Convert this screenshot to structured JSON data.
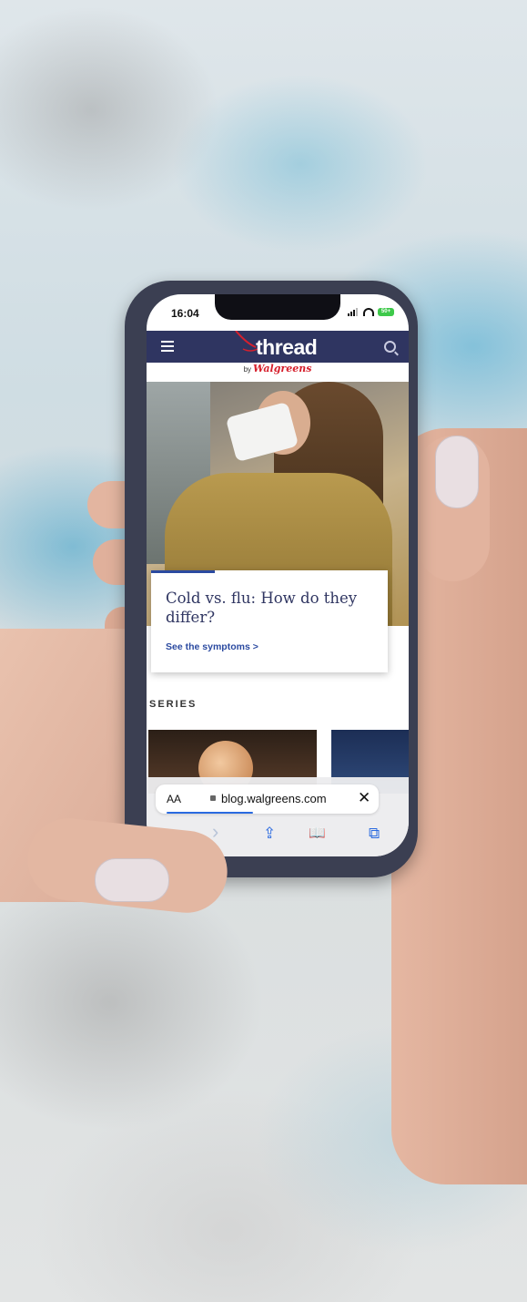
{
  "status": {
    "time": "16:04",
    "battery": "50+"
  },
  "site": {
    "logo": "thread",
    "sub_by": "by",
    "sub_brand": "Walgreens"
  },
  "hero": {
    "title": "Cold vs. flu: How do they differ?",
    "link": "See the symptoms >",
    "slides": 5,
    "active_slide": 2
  },
  "section": {
    "label": "SERIES"
  },
  "browser": {
    "text_size": "AA",
    "url": "blog.walgreens.com",
    "close": "✕"
  },
  "toolbar": {
    "back": "‹",
    "forward": "›",
    "share": "⇪",
    "bookmarks": "📖",
    "tabs": "⧉"
  },
  "colors": {
    "nav": "#2f3561",
    "accent": "#2b4aa0",
    "brand_red": "#d6202d"
  }
}
